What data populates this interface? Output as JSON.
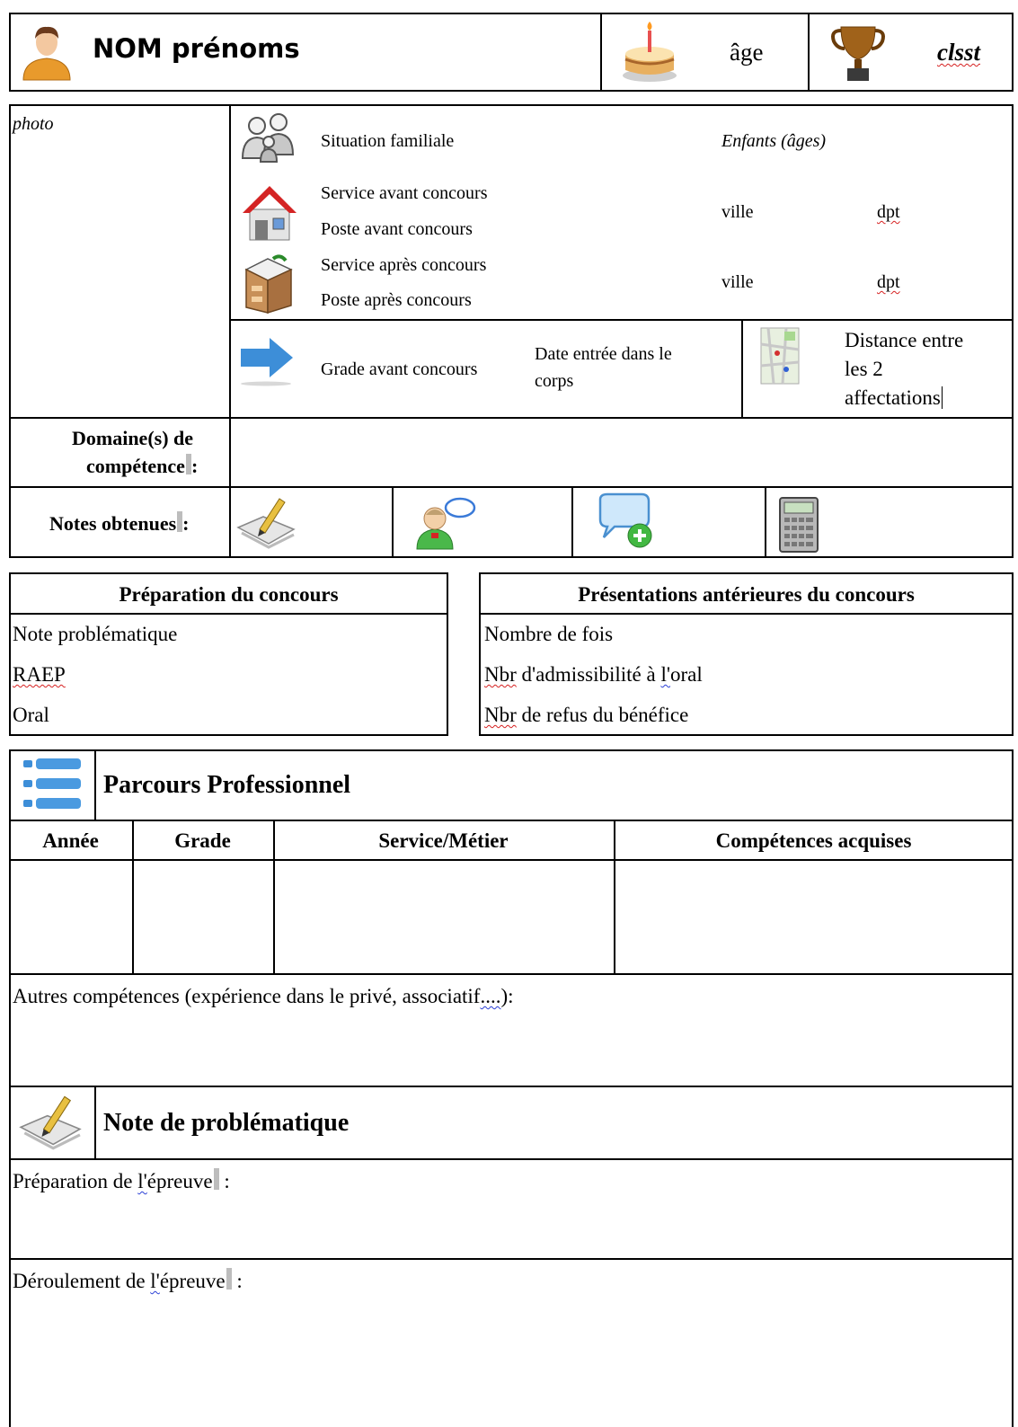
{
  "header": {
    "name_label": "NOM prénoms",
    "age_label": "âge",
    "classement_label": "clsst"
  },
  "profile": {
    "photo_label": "photo",
    "situation_familiale": "Situation familiale",
    "enfants": "Enfants (âges)",
    "service_avant": "Service avant concours",
    "poste_avant": "Poste avant concours",
    "ville_avant": "ville",
    "dpt_avant": "dpt",
    "service_apres": "Service après concours",
    "poste_apres": "Poste après concours",
    "ville_apres": "ville",
    "dpt_apres": "dpt",
    "grade_avant": "Grade avant concours",
    "date_entree_line1": "Date entrée dans le",
    "date_entree_line2": "corps",
    "distance_line1": "Distance entre",
    "distance_line2": "les 2",
    "distance_line3": "affectations"
  },
  "domaines": {
    "label_line1": "Domaine(s) de",
    "label_line2": "compétence",
    "colon": ":"
  },
  "notes": {
    "label": "Notes obtenues",
    "colon": ":"
  },
  "preparation": {
    "title": "Préparation du concours",
    "items": [
      "Note problématique",
      "RAEP",
      "Oral"
    ]
  },
  "presentations": {
    "title": "Présentations antérieures du concours",
    "item1": "Nombre de fois",
    "item2_a": "Nbr",
    "item2_b": " d'admissibilité à ",
    "item2_c": "l'",
    "item2_d": "oral",
    "item3_a": "Nbr",
    "item3_b": " de refus du bénéfice"
  },
  "parcours": {
    "title": "Parcours Professionnel",
    "columns": [
      "Année",
      "Grade",
      "Service/Métier",
      "Compétences acquises"
    ],
    "autres_a": "Autres compétences (expérience dans le privé, associatif",
    "autres_b": "....",
    "autres_c": "):"
  },
  "note_problematique": {
    "title": "Note de problématique",
    "prep_a": "Préparation de ",
    "prep_b": "l'",
    "prep_c": "épreuve",
    "prep_d": " :",
    "der_a": "Déroulement de ",
    "der_b": "l'",
    "der_c": "épreuve",
    "der_d": " :"
  },
  "colors": {
    "border": "#000000",
    "spellcheck": "#d62020",
    "grammar": "#2a3fd6",
    "accent_blue": "#3d8ed8"
  }
}
